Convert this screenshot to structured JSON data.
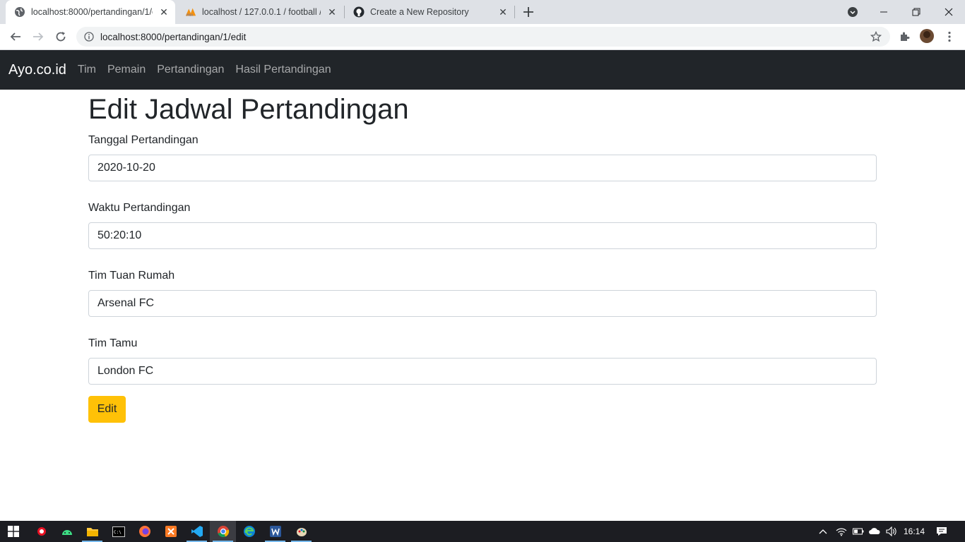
{
  "browser": {
    "tabs": [
      {
        "title": "localhost:8000/pertandingan/1/e"
      },
      {
        "title": "localhost / 127.0.0.1 / football / h"
      },
      {
        "title": "Create a New Repository"
      }
    ],
    "url": "localhost:8000/pertandingan/1/edit"
  },
  "navbar": {
    "brand": "Ayo.co.id",
    "links": [
      "Tim",
      "Pemain",
      "Pertandingan",
      "Hasil Pertandingan"
    ]
  },
  "form": {
    "title": "Edit Jadwal Pertandingan",
    "fields": [
      {
        "label": "Tanggal Pertandingan",
        "value": "2020-10-20"
      },
      {
        "label": "Waktu Pertandingan",
        "value": "50:20:10"
      },
      {
        "label": "Tim Tuan Rumah",
        "value": "Arsenal FC"
      },
      {
        "label": "Tim Tamu",
        "value": "London FC"
      }
    ],
    "submit_label": "Edit"
  },
  "colors": {
    "navbar_bg": "#212529",
    "button_bg": "#ffc107"
  },
  "taskbar": {
    "clock": "16:14"
  }
}
